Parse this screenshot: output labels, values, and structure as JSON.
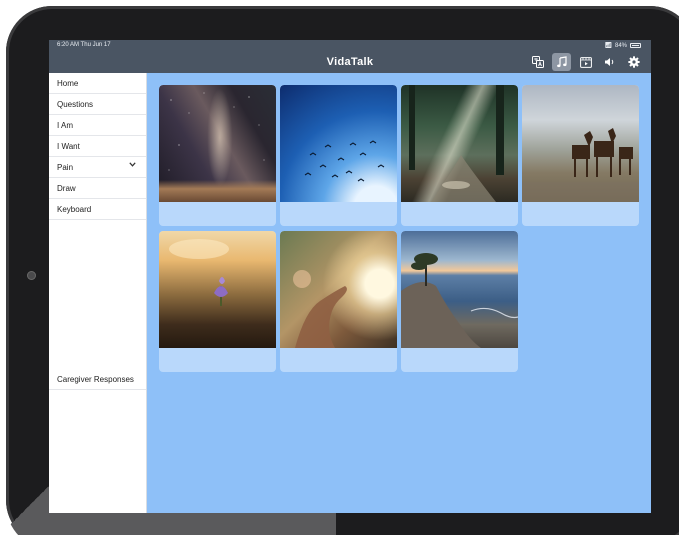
{
  "status_bar": {
    "time": "6:20 AM  Thu Jun 17",
    "battery": "84%"
  },
  "app": {
    "title": "VidaTalk"
  },
  "toolbar": {
    "icons": [
      "translate-icon",
      "music-icon",
      "video-icon",
      "volume-icon",
      "gear-icon"
    ],
    "active": "music-icon"
  },
  "sidebar": {
    "items": [
      {
        "label": "Home"
      },
      {
        "label": "Questions"
      },
      {
        "label": "I Am"
      },
      {
        "label": "I Want"
      },
      {
        "label": "Pain"
      },
      {
        "label": "Draw"
      },
      {
        "label": "Keyboard"
      }
    ],
    "caregiver_label": "Caregiver Responses"
  },
  "tiles": [
    {
      "image": "milky-way-night-sky",
      "label": ""
    },
    {
      "image": "birds-in-blue-sky",
      "label": ""
    },
    {
      "image": "sunlit-forest-stream",
      "label": ""
    },
    {
      "image": "wild-horses-field",
      "label": ""
    },
    {
      "image": "purple-crocus-sunset",
      "label": ""
    },
    {
      "image": "hand-in-sunlight",
      "label": ""
    },
    {
      "image": "coastal-cliff-cypress",
      "label": ""
    }
  ],
  "colors": {
    "content_background": "#8ec0f8",
    "tile_background": "#b9d8fb",
    "top_bar": "#4a5563"
  }
}
